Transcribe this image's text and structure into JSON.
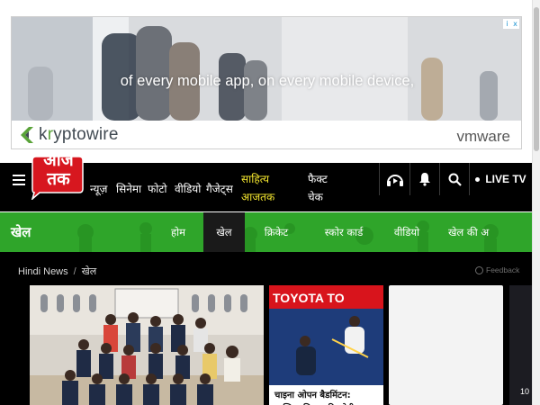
{
  "ad": {
    "headline": "of every mobile app, on every mobile device,",
    "brand_left_prefix": "k",
    "brand_left_accent": "r",
    "brand_left_suffix": "yptowire",
    "brand_right": "vmware",
    "adchoices": [
      "i",
      "x"
    ]
  },
  "header": {
    "logo_line1": "आज",
    "logo_line2": "तक",
    "nav": [
      "न्यूज़",
      "सिनेमा",
      "फोटो",
      "वीडियो",
      "गैजेट्स"
    ],
    "sahitya_line1": "साहित्य",
    "sahitya_line2": "आजतक",
    "factcheck_line1": "फैक्ट",
    "factcheck_line2": "चेक",
    "live_label": "LIVE TV",
    "icons": [
      "podcast-icon",
      "bell-icon",
      "search-icon"
    ]
  },
  "section": {
    "title": "खेल",
    "tabs": [
      {
        "label": "होम",
        "active": false
      },
      {
        "label": "खेल",
        "active": true
      },
      {
        "label": "क्रिकेट",
        "active": false
      },
      {
        "label": "स्कोर कार्ड",
        "active": false
      },
      {
        "label": "वीडियो",
        "active": false
      },
      {
        "label": "खेल की अ",
        "active": false
      }
    ],
    "brand_color": "#2fa52a"
  },
  "breadcrumb": {
    "home": "Hindi News",
    "separator": "/",
    "current": "खेल"
  },
  "feedback_label": "Feedback",
  "cards": {
    "card2_banner": "TOYOTA TO",
    "card2_caption": "चाइना ओपन बैडमिंटन: सात्विक-चिराग की जोड़ी",
    "card4_number": "10"
  }
}
